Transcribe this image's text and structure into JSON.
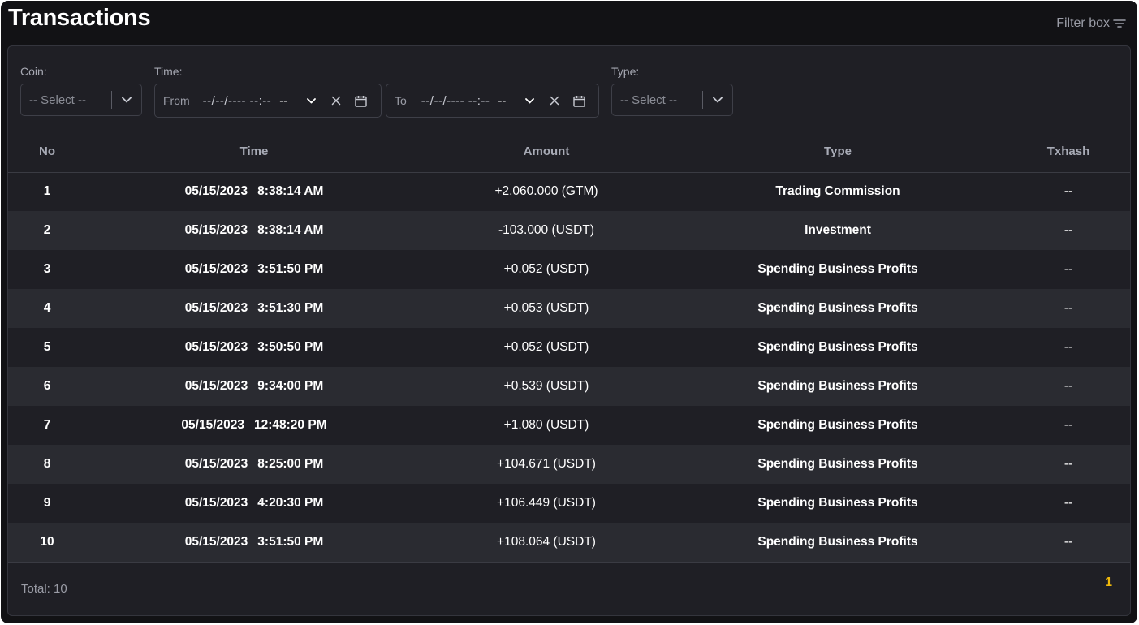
{
  "header": {
    "title": "Transactions",
    "filter_toggle_label": "Filter box",
    "filter_icon": "filter-lines-icon"
  },
  "filters": {
    "coin": {
      "label": "Coin:",
      "placeholder": "-- Select --"
    },
    "time": {
      "label": "Time:",
      "from": {
        "prefix": "From",
        "value": "--/--/---- --:--",
        "ampm": "--"
      },
      "to": {
        "prefix": "To",
        "value": "--/--/---- --:--",
        "ampm": "--"
      }
    },
    "type": {
      "label": "Type:",
      "placeholder": "-- Select --"
    }
  },
  "table": {
    "columns": [
      "No",
      "Time",
      "Amount",
      "Type",
      "Txhash"
    ],
    "rows": [
      {
        "no": "1",
        "date": "05/15/2023",
        "time": "8:38:14 AM",
        "amount": "+2,060.000 (GTM)",
        "sign": "pos",
        "type": "Trading Commission",
        "txhash": "--"
      },
      {
        "no": "2",
        "date": "05/15/2023",
        "time": "8:38:14 AM",
        "amount": "-103.000 (USDT)",
        "sign": "neg",
        "type": "Investment",
        "txhash": "--"
      },
      {
        "no": "3",
        "date": "05/15/2023",
        "time": "3:51:50 PM",
        "amount": "+0.052 (USDT)",
        "sign": "pos",
        "type": "Spending Business Profits",
        "txhash": "--"
      },
      {
        "no": "4",
        "date": "05/15/2023",
        "time": "3:51:30 PM",
        "amount": "+0.053 (USDT)",
        "sign": "pos",
        "type": "Spending Business Profits",
        "txhash": "--"
      },
      {
        "no": "5",
        "date": "05/15/2023",
        "time": "3:50:50 PM",
        "amount": "+0.052 (USDT)",
        "sign": "pos",
        "type": "Spending Business Profits",
        "txhash": "--"
      },
      {
        "no": "6",
        "date": "05/15/2023",
        "time": "9:34:00 PM",
        "amount": "+0.539 (USDT)",
        "sign": "pos",
        "type": "Spending Business Profits",
        "txhash": "--"
      },
      {
        "no": "7",
        "date": "05/15/2023",
        "time": "12:48:20 PM",
        "amount": "+1.080 (USDT)",
        "sign": "pos",
        "type": "Spending Business Profits",
        "txhash": "--"
      },
      {
        "no": "8",
        "date": "05/15/2023",
        "time": "8:25:00 PM",
        "amount": "+104.671 (USDT)",
        "sign": "pos",
        "type": "Spending Business Profits",
        "txhash": "--"
      },
      {
        "no": "9",
        "date": "05/15/2023",
        "time": "4:20:30 PM",
        "amount": "+106.449 (USDT)",
        "sign": "pos",
        "type": "Spending Business Profits",
        "txhash": "--"
      },
      {
        "no": "10",
        "date": "05/15/2023",
        "time": "3:51:50 PM",
        "amount": "+108.064 (USDT)",
        "sign": "pos",
        "type": "Spending Business Profits",
        "txhash": "--"
      }
    ]
  },
  "footer": {
    "total": "Total: 10",
    "current_page": "1"
  },
  "colors": {
    "background": "#121215",
    "panel": "#1f1f25",
    "row_alt": "#2a2b31",
    "positive": "#57d04e",
    "negative": "#ff4d4f",
    "accent": "#f0b90b"
  }
}
